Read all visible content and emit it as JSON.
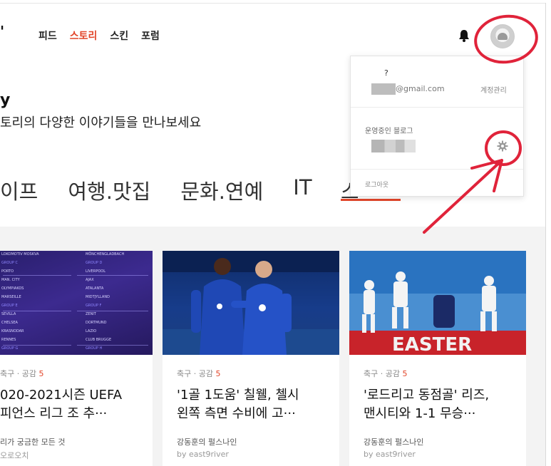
{
  "header": {
    "logo_fragment": "'",
    "nav": [
      {
        "label": "피드",
        "active": false
      },
      {
        "label": "스토리",
        "active": true
      },
      {
        "label": "스킨",
        "active": false
      },
      {
        "label": "포럼",
        "active": false
      }
    ],
    "icons": [
      "bell-icon",
      "avatar"
    ]
  },
  "hero": {
    "title_fragment": "y",
    "description": "토리의 다양한 이야기들을 만나보세요"
  },
  "categories": {
    "items": [
      "이프",
      "여행.맛집",
      "문화.연예",
      "IT"
    ],
    "active_fragment": "스",
    "active_color": "#e2462a"
  },
  "dropdown": {
    "name": "?",
    "email": "@gmail.com",
    "account_link": "계정관리",
    "blog_section_label": "운영중인 블로그",
    "logout": "로그아웃",
    "icons": [
      "gear-icon"
    ]
  },
  "cards": [
    {
      "category": "축구",
      "likes_label": "공감",
      "likes": "5",
      "title_line1": "020-2021시즌 UEFA",
      "title_line2": "피언스 리그 조 추···",
      "blog": "리가 궁금한 모든 것",
      "author": "오로오치",
      "image": {
        "type": "draw-bracket",
        "left_col": [
          "LOKOMOTIV MOSKVA",
          "GROUP C",
          "PORTO",
          "MAN. CITY",
          "OLYMPIAKOS",
          "MARSEILLE",
          "GROUP E",
          "SEVILLA",
          "CHELSEA",
          "KRASNODAR",
          "RENNES",
          "GROUP G"
        ],
        "right_col": [
          "MÖNCHENGLADBACH",
          "GROUP D",
          "LIVERPOOL",
          "AJAX",
          "ATALANTA",
          "MIDTJYLLAND",
          "GROUP F",
          "ZENIT",
          "DORTMUND",
          "LAZIO",
          "CLUB BRUGGE",
          "GROUP H"
        ]
      }
    },
    {
      "category": "축구",
      "likes_label": "공감",
      "likes": "5",
      "title_line1": "'1골 1도움' 칠웰, 첼시",
      "title_line2": "왼쪽 측면 수비에 고···",
      "blog": "강동훈의 펄스나인",
      "author": "by east9river"
    },
    {
      "category": "축구",
      "likes_label": "공감",
      "likes": "5",
      "title_line1": "'로드리고 동점골' 리즈,",
      "title_line2": "맨시티와 1-1 무승···",
      "blog": "강동훈의 펄스나인",
      "author": "by east9river",
      "image": {
        "banner_text": "EASTER"
      }
    }
  ],
  "colors": {
    "accent": "#e2462a",
    "annotation": "#e0233a"
  }
}
